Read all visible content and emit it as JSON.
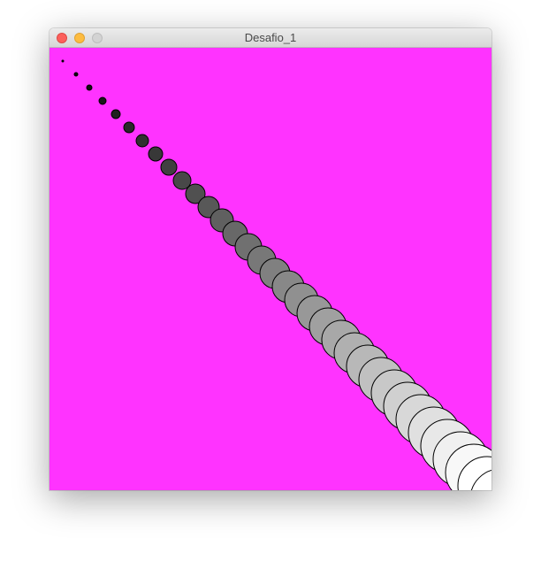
{
  "window": {
    "title": "Desafio_1"
  },
  "titlebar_buttons": [
    {
      "name": "close",
      "color": "#fc605c"
    },
    {
      "name": "minimize",
      "color": "#fdbc40"
    },
    {
      "name": "zoom",
      "color": "#d3d3d3"
    }
  ],
  "canvas": {
    "background": "#ff33ff",
    "circle_stroke": "#000000",
    "circle_count": 34,
    "fill_gray_levels": [
      0,
      8,
      16,
      24,
      32,
      40,
      48,
      56,
      64,
      72,
      80,
      88,
      96,
      104,
      112,
      120,
      128,
      136,
      144,
      152,
      160,
      168,
      176,
      184,
      192,
      200,
      208,
      216,
      224,
      232,
      240,
      248,
      255,
      255
    ]
  }
}
